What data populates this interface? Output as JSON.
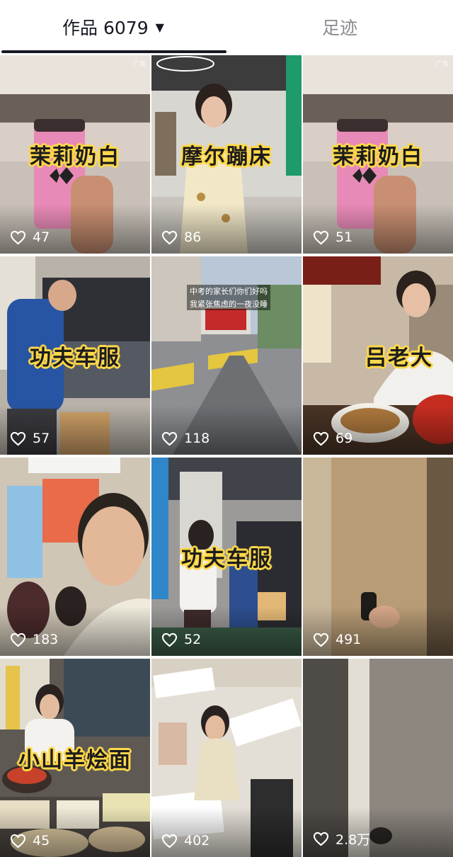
{
  "tabs": {
    "works_label": "作品 6079",
    "footprint_label": "足迹"
  },
  "videos": [
    {
      "caption": "茉莉奶白",
      "likes": "47",
      "ad": "广告"
    },
    {
      "caption": "摩尔蹦床",
      "likes": "86"
    },
    {
      "caption": "茉莉奶白",
      "likes": "51",
      "ad": "广告"
    },
    {
      "caption": "功夫车服",
      "likes": "57"
    },
    {
      "caption": "",
      "likes": "118",
      "overlay_line1": "中考的家长们你们好吗",
      "overlay_line2": "我紧张焦虑的一夜没睡"
    },
    {
      "caption": "吕老大",
      "likes": "69"
    },
    {
      "caption": "",
      "likes": "183"
    },
    {
      "caption": "功夫车服",
      "likes": "52"
    },
    {
      "caption": "",
      "likes": "491"
    },
    {
      "caption": "小山羊烩面",
      "likes": "45"
    },
    {
      "caption": "",
      "likes": "402"
    },
    {
      "caption": "",
      "likes": "2.8万"
    }
  ],
  "colors": {
    "active_tab": "#161823",
    "inactive_tab": "#8a8b91",
    "caption_outline": "#ffd84a"
  }
}
